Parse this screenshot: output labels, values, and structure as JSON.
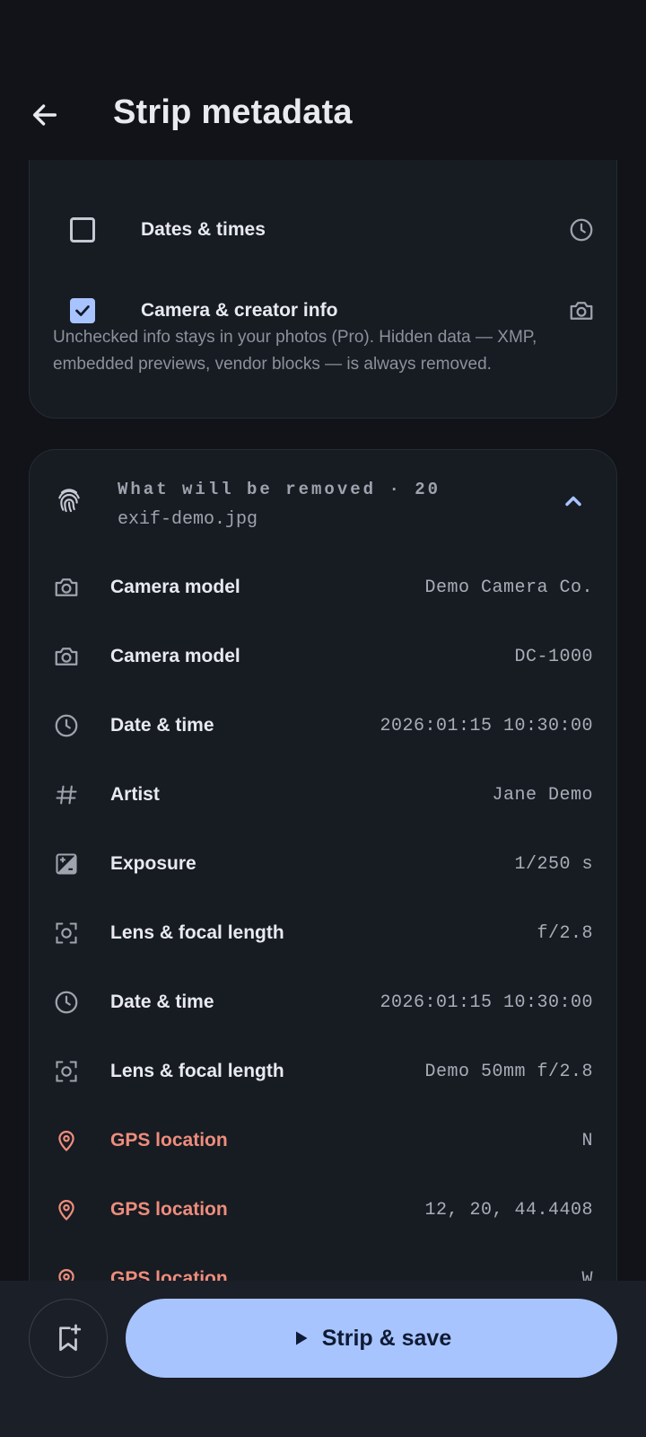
{
  "header": {
    "title": "Strip metadata",
    "back_icon": "arrow-left-icon"
  },
  "options": [
    {
      "label": "Dates & times",
      "checked": false,
      "icon": "clock-icon"
    },
    {
      "label": "Camera & creator info",
      "checked": true,
      "icon": "camera-icon"
    }
  ],
  "options_note": "Unchecked info stays in your photos (Pro). Hidden data — XMP, embedded previews, vendor blocks — is always removed.",
  "removal": {
    "title": "What will be removed · 20",
    "filename": "exif-demo.jpg",
    "icon": "fingerprint-icon",
    "expanded": true,
    "items": [
      {
        "label": "Camera model",
        "value": "Demo Camera Co.",
        "icon": "camera-icon"
      },
      {
        "label": "Camera model",
        "value": "DC-1000",
        "icon": "camera-icon"
      },
      {
        "label": "Date & time",
        "value": "2026:01:15 10:30:00",
        "icon": "clock-icon"
      },
      {
        "label": "Artist",
        "value": "Jane Demo",
        "icon": "hash-icon"
      },
      {
        "label": "Exposure",
        "value": "1/250 s",
        "icon": "exposure-icon"
      },
      {
        "label": "Lens & focal length",
        "value": "f/2.8",
        "icon": "lens-icon"
      },
      {
        "label": "Date & time",
        "value": "2026:01:15 10:30:00",
        "icon": "clock-icon"
      },
      {
        "label": "Lens & focal length",
        "value": "Demo 50mm f/2.8",
        "icon": "lens-icon"
      },
      {
        "label": "GPS location",
        "value": "N",
        "icon": "location-pin-icon"
      },
      {
        "label": "GPS location",
        "value": "12, 20, 44.4408",
        "icon": "location-pin-icon"
      },
      {
        "label": "GPS location",
        "value": "W",
        "icon": "location-pin-icon"
      }
    ]
  },
  "actions": {
    "strip_label": "Strip & save",
    "bookmark_icon": "bookmark-add-icon"
  },
  "colors": {
    "background": "#111318",
    "card": "#171b22",
    "accent": "#a8c4ff",
    "gps_label": "#ee8d7c"
  }
}
